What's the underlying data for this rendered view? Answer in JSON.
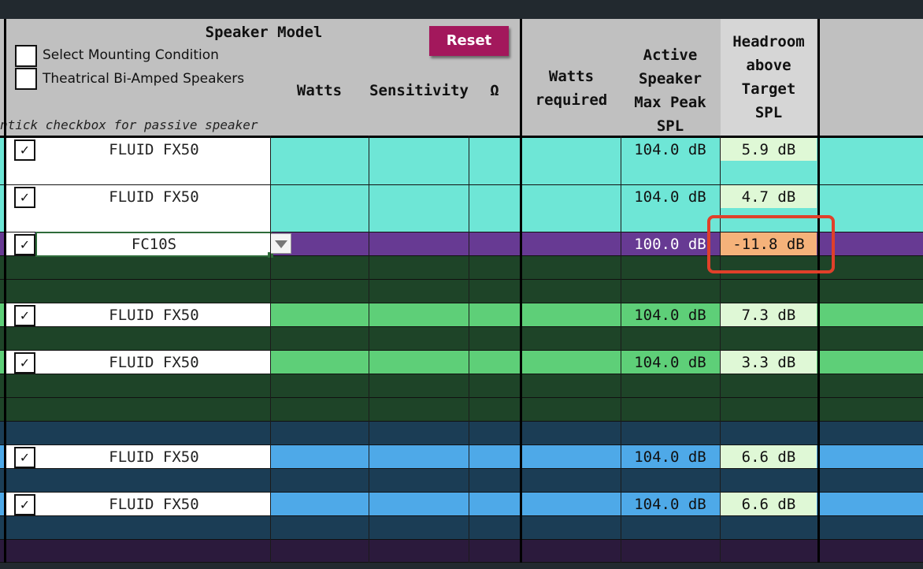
{
  "header": {
    "speaker_model": "Speaker Model",
    "select_mounting": "Select Mounting Condition",
    "theatrical": "Theatrical Bi-Amped Speakers",
    "hint": "ntick checkbox for passive speaker",
    "reset": "Reset",
    "watts": "Watts",
    "sensitivity": "Sensitivity",
    "ohm": "Ω",
    "watts_required": [
      "Watts",
      "required"
    ],
    "active_max": [
      "Active",
      "Speaker",
      "Max Peak",
      "SPL"
    ],
    "headroom": [
      "Headroom",
      "above",
      "Target",
      "SPL"
    ]
  },
  "rows": [
    {
      "checked": true,
      "model": "FLUID FX50",
      "max_spl": "104.0 dB",
      "headroom": "5.9 dB"
    },
    {
      "checked": true,
      "model": "FLUID FX50",
      "max_spl": "104.0 dB",
      "headroom": "4.7 dB"
    },
    {
      "checked": true,
      "model": "FC10S",
      "max_spl": "100.0 dB",
      "headroom": "-11.8 dB",
      "highlighted": true
    },
    {
      "checked": true,
      "model": "FLUID FX50",
      "max_spl": "104.0 dB",
      "headroom": "7.3 dB"
    },
    {
      "checked": true,
      "model": "FLUID FX50",
      "max_spl": "104.0 dB",
      "headroom": "3.3 dB"
    },
    {
      "checked": true,
      "model": "FLUID FX50",
      "max_spl": "104.0 dB",
      "headroom": "6.6 dB"
    },
    {
      "checked": true,
      "model": "FLUID FX50",
      "max_spl": "104.0 dB",
      "headroom": "6.6 dB"
    }
  ],
  "check_glyph": "✓",
  "dropdown_icon": "chevron-down-icon",
  "colors": {
    "teal": "#6ee6d6",
    "purple": "#673a93",
    "dark_green": "#1e4428",
    "green": "#5ecf78",
    "dark_blue": "#1b3d55",
    "blue": "#4ea9e8",
    "headroom_ok": "#dff8d6",
    "headroom_bad": "#f5b27a",
    "highlight": "#e0402a",
    "reset": "#a3185c"
  }
}
